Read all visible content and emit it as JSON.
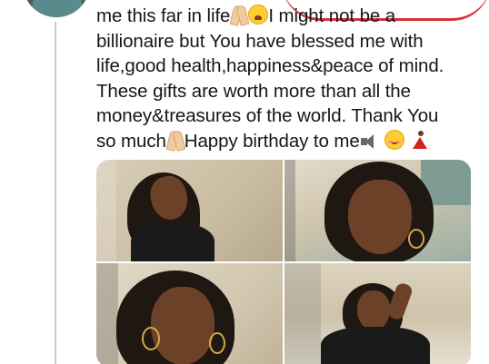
{
  "tweet": {
    "lines": [
      {
        "before": "me this far in life",
        "emoji1": "folded-hands",
        "emoji2": "weary-face",
        "after": "I might not be a"
      },
      {
        "text": "billionaire but You have blessed me with"
      },
      {
        "text": "life,good health,happiness&peace of mind."
      },
      {
        "text": "These gifts are worth more than all the"
      },
      {
        "text": "money&treasures of the world. Thank You"
      },
      {
        "before": "so much",
        "emoji1": "folded-hands",
        "after": "Happy birthday to me",
        "emoji2": "speaker",
        "emoji3": "smiling-face",
        "emoji4": "dancer"
      }
    ]
  },
  "colors": {
    "text": "#14171a",
    "thread_line": "#c6ced6",
    "highlight_mark": "#d6323c"
  },
  "media": {
    "photos": [
      {
        "icon": "photo-selfie-wall-1"
      },
      {
        "icon": "photo-selfie-closeup-1"
      },
      {
        "icon": "photo-selfie-closeup-2"
      },
      {
        "icon": "photo-selfie-posing"
      }
    ]
  }
}
